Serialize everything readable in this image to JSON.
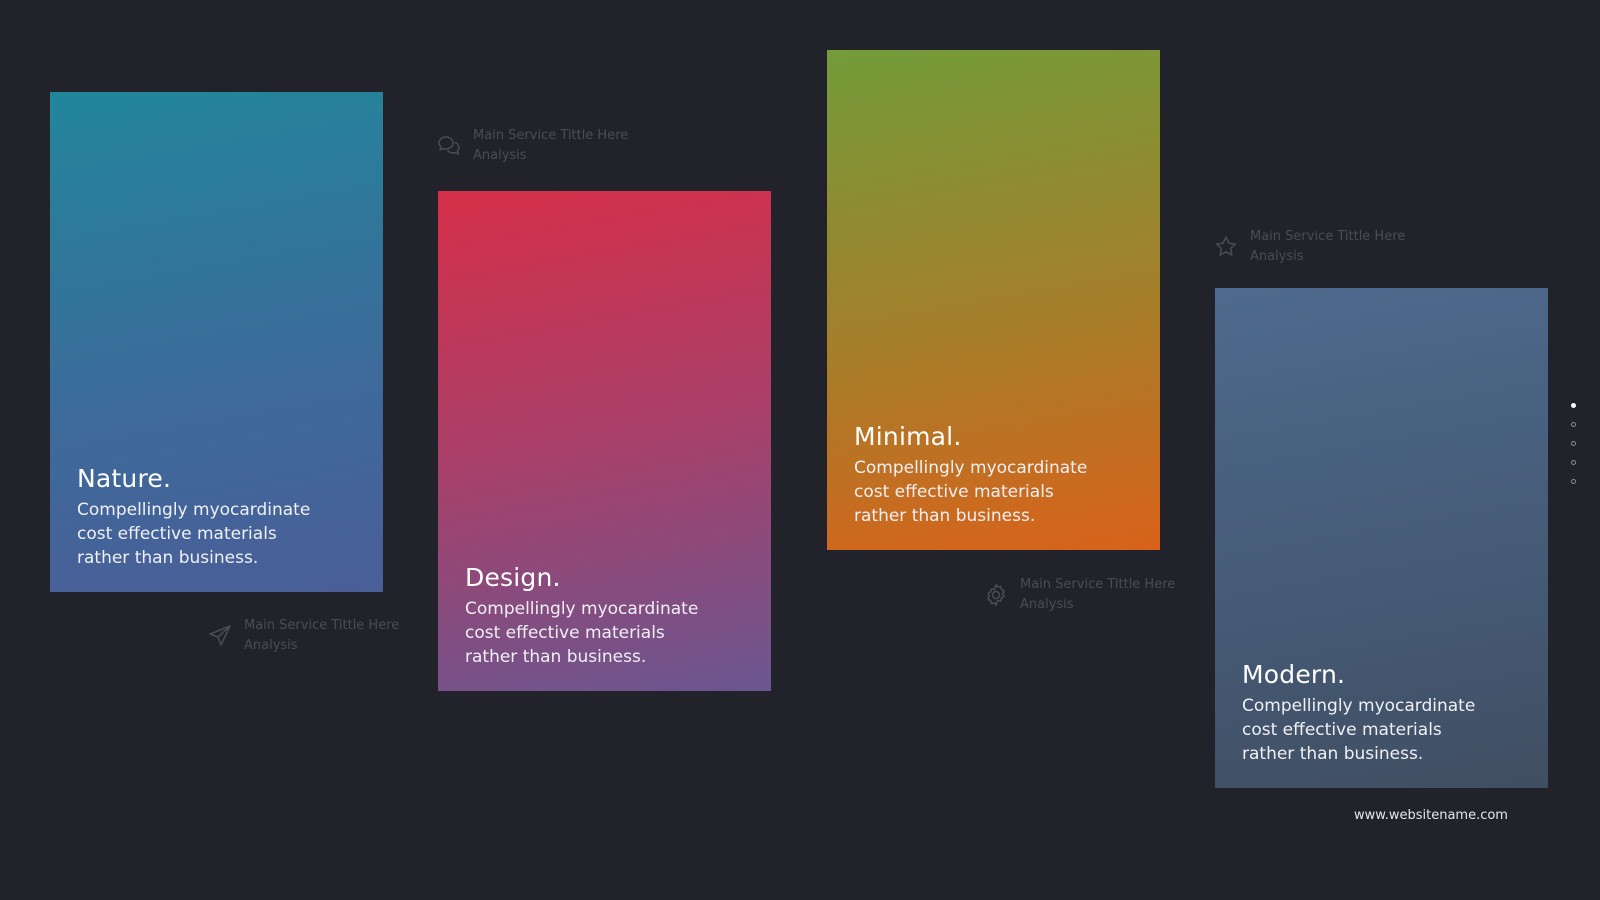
{
  "cards": [
    {
      "title": "Nature.",
      "desc": [
        "Compellingly myocardinate",
        "cost effective materials",
        "rather than business."
      ]
    },
    {
      "title": "Design.",
      "desc": [
        "Compellingly myocardinate",
        "cost effective materials",
        "rather than business."
      ]
    },
    {
      "title": "Minimal.",
      "desc": [
        "Compellingly myocardinate",
        "cost effective materials",
        "rather than business."
      ]
    },
    {
      "title": "Modern.",
      "desc": [
        "Compellingly myocardinate",
        "cost effective materials",
        "rather than business."
      ]
    }
  ],
  "services": [
    {
      "icon": "chat-icon",
      "title": "Main Service Tittle Here",
      "subtitle": "Analysis"
    },
    {
      "icon": "send-icon",
      "title": "Main Service Tittle Here",
      "subtitle": "Analysis"
    },
    {
      "icon": "gear-icon",
      "title": "Main Service Tittle Here",
      "subtitle": "Analysis"
    },
    {
      "icon": "star-icon",
      "title": "Main Service Tittle Here",
      "subtitle": "Analysis"
    }
  ],
  "pagination": {
    "count": 5,
    "active_index": 0
  },
  "footer": {
    "website": "www.websitename.com"
  },
  "colors": {
    "background": "#22232a",
    "nature": "#22869b",
    "design": "#d62f48",
    "minimal": "#d9621a",
    "modern": "#4e6a8e"
  }
}
